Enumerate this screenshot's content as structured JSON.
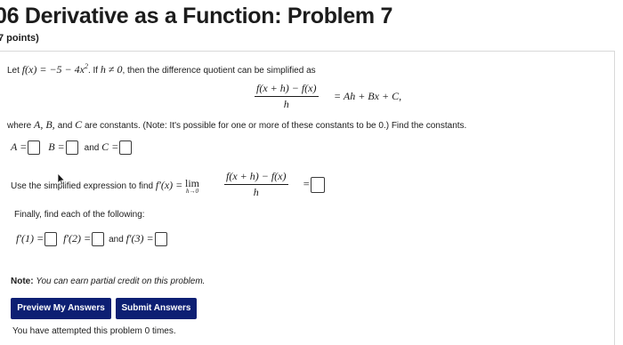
{
  "header": {
    "title": "06 Derivative as a Function: Problem 7",
    "points": "7 points)"
  },
  "problem": {
    "let_prefix": "Let ",
    "fx": "f(x) = −5 − 4x",
    "fx_exp": "2",
    "mid": ". If ",
    "h_cond": "h ≠ 0",
    "diff_text": ", then the difference quotient can be simplified as",
    "dq_num": "f(x + h) − f(x)",
    "dq_den": "h",
    "dq_rhs": "= Ah + Bx + C,",
    "where_prefix": "where ",
    "where_vars": "A, B, ",
    "and_word": "and ",
    "where_c": "C",
    "where_text": " are constants. (Note: It's possible for one or more of these constants to be 0.) Find the constants.",
    "a_label": "A =",
    "b_label": "B =",
    "and_label": "and",
    "c_label": "C =",
    "use_text": "Use the simplified expression to find",
    "fprime_x": "f′(x) =",
    "lim_word": "lim",
    "lim_sub": "h→0",
    "lim_num": "f(x + h) − f(x)",
    "lim_den": "h",
    "equals": "=",
    "finally_text": "Finally, find each of the following:",
    "f1": "f′(1) =",
    "f2": "f′(2) =",
    "f3_and": "and",
    "f3": "f′(3) ="
  },
  "note": {
    "label": "Note:",
    "text": "You can earn partial credit on this problem."
  },
  "buttons": {
    "preview": "Preview My Answers",
    "submit": "Submit Answers"
  },
  "footer": {
    "attempts": "You have attempted this problem 0 times."
  }
}
